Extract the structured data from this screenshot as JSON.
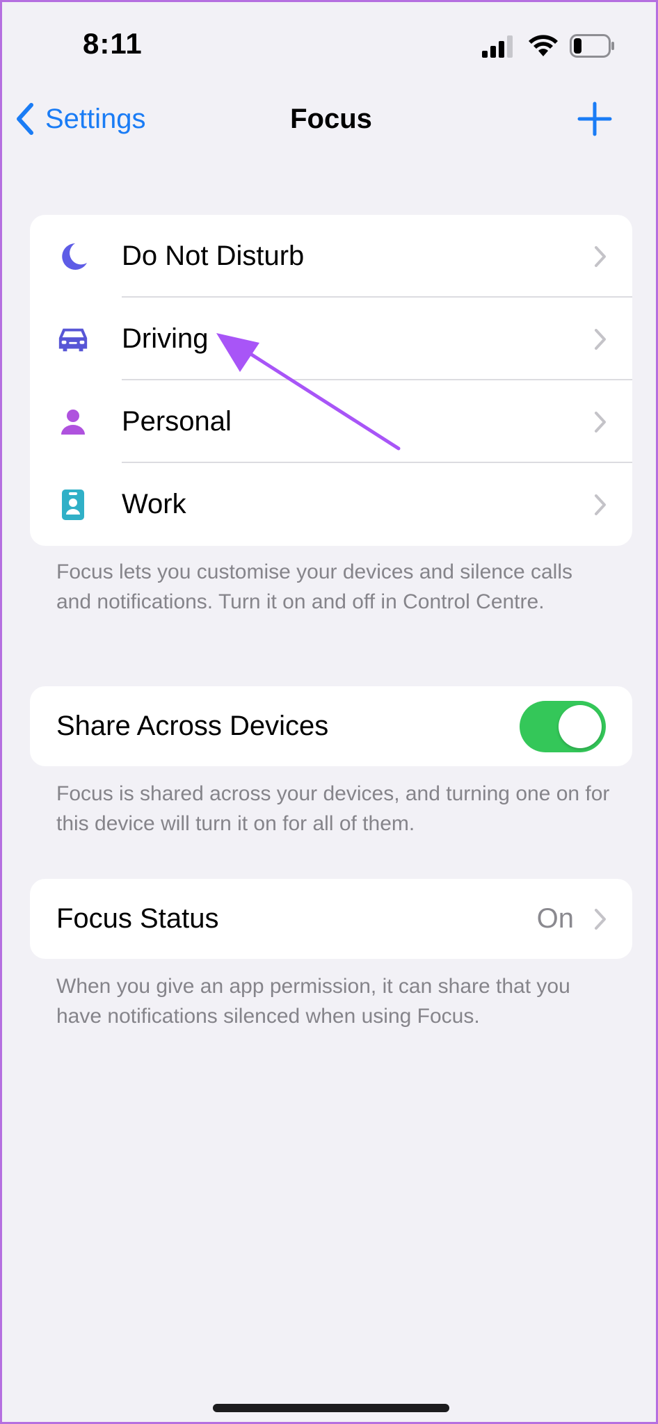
{
  "status_bar": {
    "time": "8:11"
  },
  "nav": {
    "back_label": "Settings",
    "title": "Focus"
  },
  "focus_modes": [
    {
      "label": "Do Not Disturb",
      "icon": "moon-icon",
      "color": "#5e5ce6"
    },
    {
      "label": "Driving",
      "icon": "car-icon",
      "color": "#5856d6"
    },
    {
      "label": "Personal",
      "icon": "person-icon",
      "color": "#af52de"
    },
    {
      "label": "Work",
      "icon": "id-badge-icon",
      "color": "#30b0c7"
    }
  ],
  "focus_note": "Focus lets you customise your devices and silence calls and notifications. Turn it on and off in Control Centre.",
  "share": {
    "label": "Share Across Devices",
    "enabled": true,
    "note": "Focus is shared across your devices, and turning one on for this device will turn it on for all of them."
  },
  "status": {
    "label": "Focus Status",
    "value": "On",
    "note": "When you give an app permission, it can share that you have notifications silenced when using Focus."
  },
  "colors": {
    "accent": "#1a7cf5",
    "toggle_on": "#34c759",
    "annotation_arrow": "#a855f7"
  }
}
